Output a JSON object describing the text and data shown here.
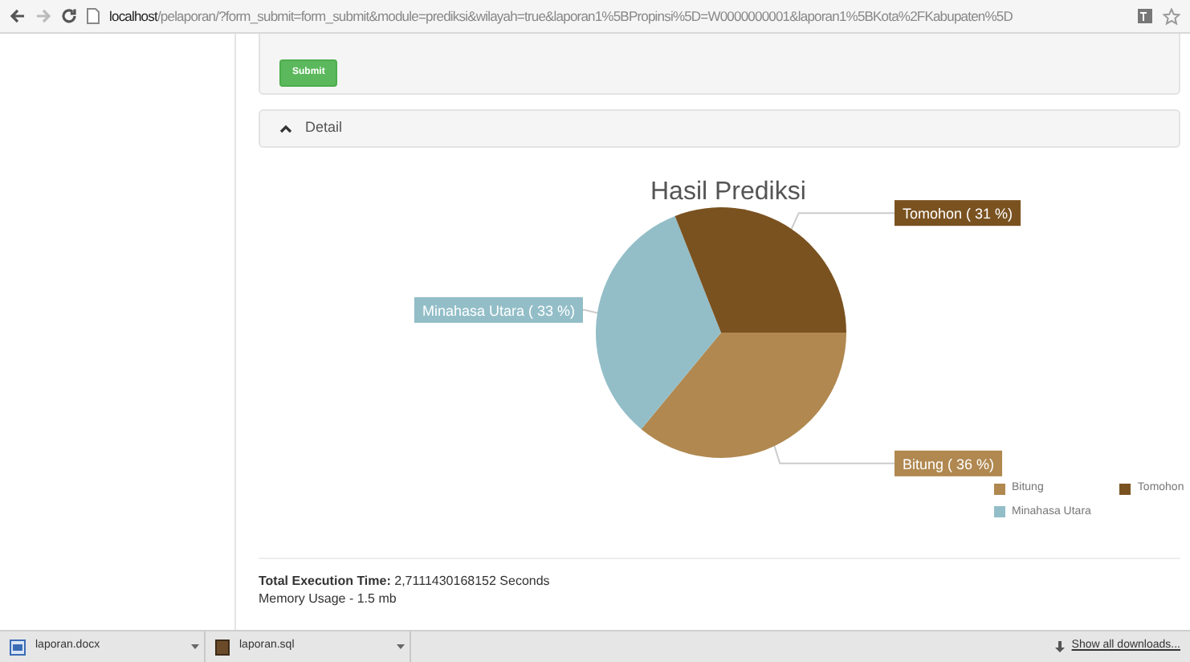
{
  "browser": {
    "url_host": "localhost",
    "url_path": "/pelaporan/?form_submit=form_submit&module=prediksi&wilayah=true&laporan1%5BPropinsi%5D=W0000000001&laporan1%5BKota%2FKabupaten%5D"
  },
  "form": {
    "submit_button": "Submit"
  },
  "detail_panel": {
    "title": "Detail",
    "expanded": true
  },
  "chart": {
    "chart_data": {
      "type": "pie",
      "title": "Hasil Prediksi",
      "categories": [
        "Bitung",
        "Minahasa Utara",
        "Tomohon"
      ],
      "values": [
        36,
        33,
        31
      ],
      "legend": true,
      "colors": [
        "#b08850",
        "#93bec8",
        "#7a5220"
      ],
      "value_labels": [
        "Bitung ( 36 %)",
        "Minahasa Utara ( 33 %)",
        "Tomohon ( 31 %)"
      ]
    }
  },
  "footer": {
    "execution": "**Total Execution Time:** 2,7111430168152 Seconds",
    "memory": "Memory Usage - 1.5 mb"
  },
  "downloads": {
    "items": [
      {
        "name": "laporan.docx",
        "kind": "doc"
      },
      {
        "name": "laporan.sql",
        "kind": "sql"
      }
    ],
    "show_all": "Show all downloads..."
  }
}
